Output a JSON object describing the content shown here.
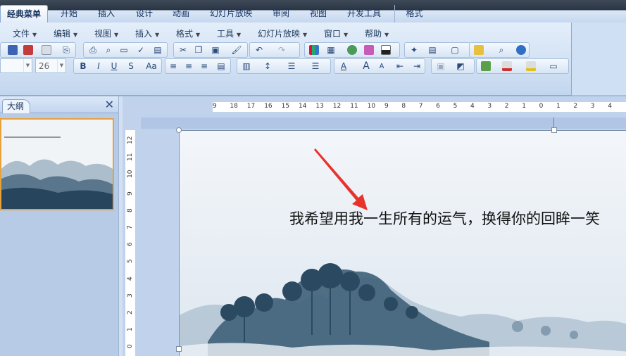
{
  "ribbon_tabs": [
    "经典菜单",
    "开始",
    "插入",
    "设计",
    "动画",
    "幻灯片放映",
    "审阅",
    "视图",
    "开发工具",
    "格式"
  ],
  "menu_bar": [
    "文件",
    "编辑",
    "视图",
    "插入",
    "格式",
    "工具",
    "幻灯片放映",
    "窗口",
    "帮助"
  ],
  "font": {
    "name": "",
    "size": "26"
  },
  "toolbar_formatting": {
    "bold": "B",
    "italic": "I",
    "underline": "U",
    "shadow": "S",
    "change_case": "Aa",
    "font_color": "A",
    "grow_font": "A",
    "shrink_font": "A"
  },
  "toolbar_icons": [
    "save-icon",
    "permission-icon",
    "email-icon",
    "attach-icon",
    "print-icon",
    "print-preview-icon",
    "research-icon",
    "spelling-icon",
    "cut-icon",
    "copy-icon",
    "paste-icon",
    "format-painter-icon",
    "undo-icon",
    "redo-icon",
    "chart-icon",
    "table-icon",
    "hyperlink-icon",
    "color-grayscale-icon",
    "black-white-icon",
    "new-slide-icon",
    "layout-icon",
    "textbox-icon",
    "shapes-icon",
    "zoom-icon",
    "help-icon"
  ],
  "outline_pane": {
    "tab_label": "大纲",
    "close": "✕"
  },
  "rulers": {
    "horizontal": [
      "9",
      "18",
      "17",
      "16",
      "15",
      "14",
      "13",
      "12",
      "11",
      "10",
      "9",
      "8",
      "7",
      "6",
      "5",
      "4",
      "3",
      "2",
      "1",
      "0",
      "1",
      "2",
      "3",
      "4"
    ],
    "vertical": [
      "12",
      "11",
      "10",
      "9",
      "8",
      "7",
      "6",
      "5",
      "4",
      "3",
      "2",
      "1",
      "0"
    ]
  },
  "slide": {
    "text": "我希望用我一生所有的运气，换得你的回眸一笑"
  },
  "colors": {
    "accent": "#e8a23a",
    "ribbon_text": "#15315d",
    "arrow": "#e8332d"
  }
}
